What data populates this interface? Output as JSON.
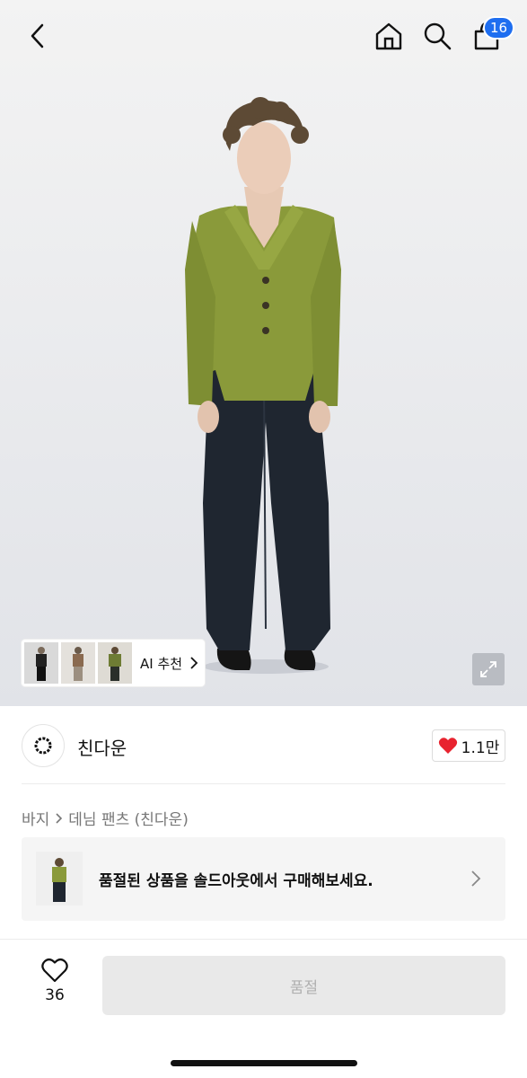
{
  "header": {
    "cart_count": "16",
    "icons": [
      "chevron-left-icon",
      "home-icon",
      "search-icon",
      "shopping-bag-icon"
    ]
  },
  "hero": {
    "ai_label": "AI 추천",
    "colors": {
      "jacket": "#8a9a3a",
      "pants": "#1f2630",
      "background": "#f3f3f3"
    }
  },
  "brand": {
    "name": "친다운",
    "likes": "1.1만"
  },
  "breadcrumb": {
    "category": "바지",
    "item": "데님 팬츠 (친다운)"
  },
  "soldout_card": {
    "text": "품절된 상품을 솔드아웃에서 구매해보세요."
  },
  "bottom": {
    "wish_count": "36",
    "button_label": "품절"
  }
}
